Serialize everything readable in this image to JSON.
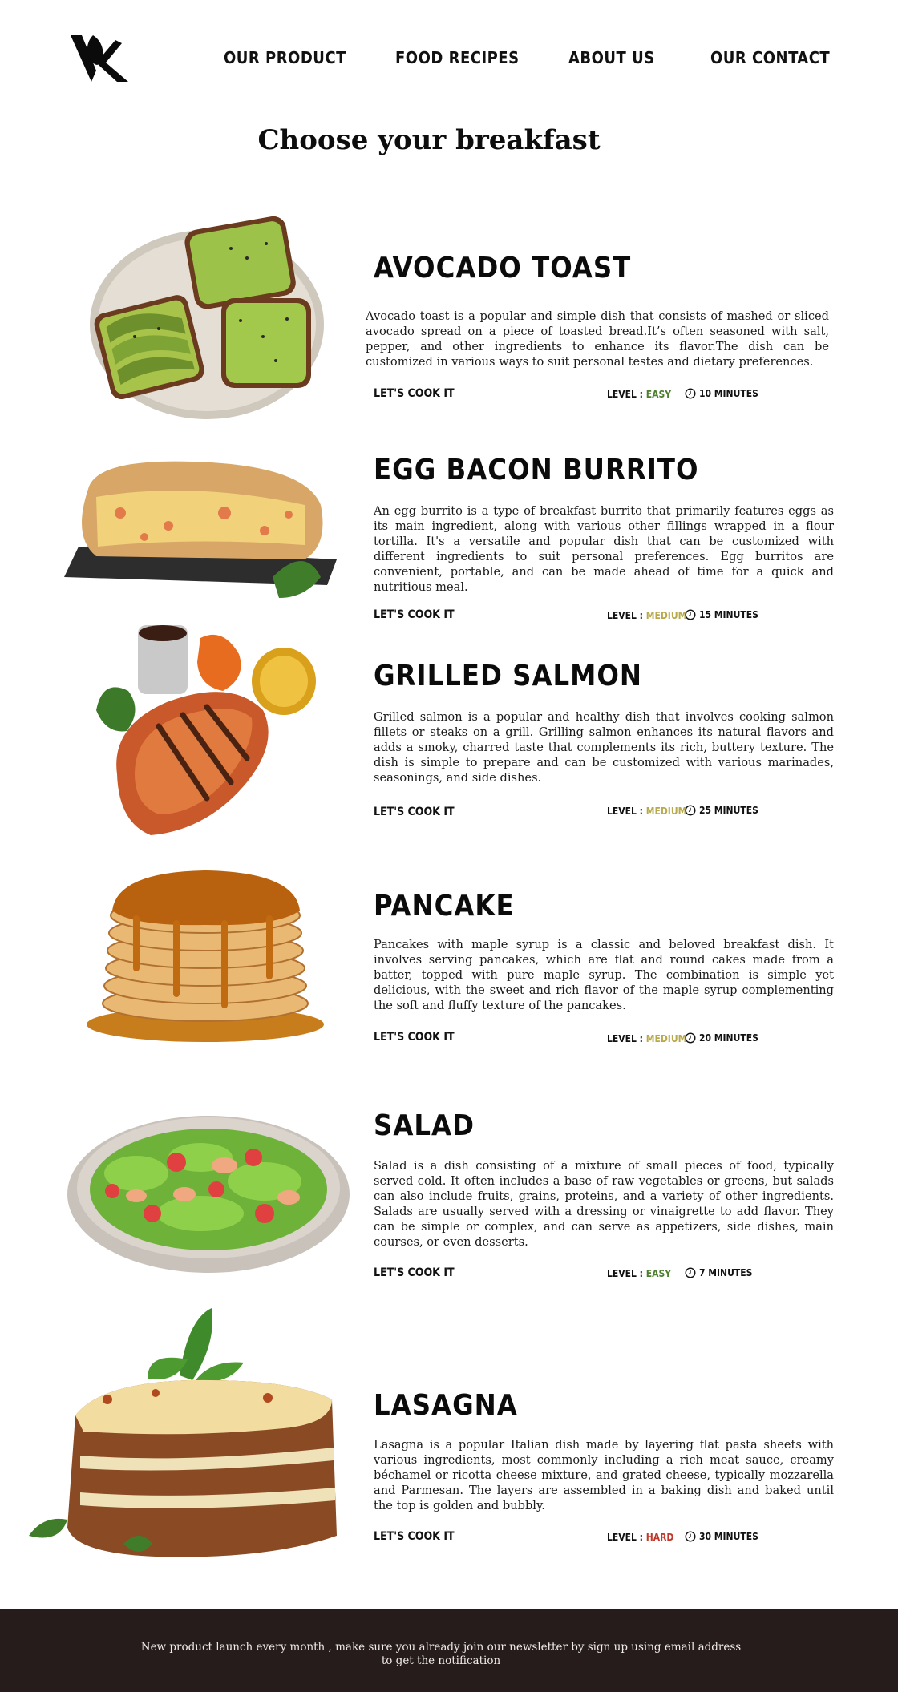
{
  "header": {
    "nav": [
      "OUR PRODUCT",
      "FOOD RECIPES",
      "ABOUT US",
      "OUR CONTACT"
    ]
  },
  "page_title": "Choose your breakfast",
  "colors": {
    "easy": "#4e7f2e",
    "medium": "#b8a94a",
    "hard": "#c0392b",
    "footer_bg": "#261c1c"
  },
  "recipes": [
    {
      "name": "AVOCADO TOAST",
      "description": "Avocado toast is a popular and simple dish that consists of mashed or sliced avocado spread on a piece of toasted bread.It’s often seasoned with salt, pepper, and other ingredients to enhance its flavor.The dish can be customized in various ways to suit personal testes and dietary preferences.",
      "cta": "LET'S COOK IT",
      "level_label": "LEVEL :",
      "level": "EASY",
      "time": "10 MINUTES",
      "image": "avocado-toast-plate"
    },
    {
      "name": "EGG BACON BURRITO",
      "description": "An egg burrito is a type of breakfast burrito that primarily features eggs as its main ingredient, along with various other fillings wrapped in a flour tortilla. It's a versatile and popular dish that can be customized with different ingredients to suit personal preferences. Egg burritos are convenient, portable, and can be made ahead of time for a quick and nutritious meal.",
      "cta": "LET'S COOK IT",
      "level_label": "LEVEL :",
      "level": "MEDIUM",
      "time": "15 MINUTES",
      "image": "egg-burrito-board"
    },
    {
      "name": "GRILLED SALMON",
      "description": "Grilled salmon is a popular and healthy dish that involves cooking salmon fillets or steaks on a grill. Grilling salmon enhances its natural flavors and adds a smoky, charred taste that complements its rich, buttery texture. The dish is simple to prepare and can be customized with various marinades, seasonings, and side dishes.",
      "cta": "LET'S COOK IT",
      "level_label": "LEVEL :",
      "level": "MEDIUM",
      "time": "25 MINUTES",
      "image": "grilled-salmon-lemon"
    },
    {
      "name": "PANCAKE",
      "description": "Pancakes with maple syrup is a classic and beloved breakfast dish. It involves serving pancakes, which are flat and round cakes made from a batter, topped with pure maple syrup. The combination is simple yet delicious, with the sweet and rich flavor of the maple syrup complementing the soft and fluffy texture of the pancakes.",
      "cta": "LET'S COOK IT",
      "level_label": "LEVEL :",
      "level": "MEDIUM",
      "time": "20 MINUTES",
      "image": "pancake-stack-syrup"
    },
    {
      "name": "SALAD",
      "description": "Salad is a dish consisting of a mixture of small pieces of food, typically served cold. It often includes a base of raw vegetables or greens, but salads can also include fruits, grains, proteins, and a variety of other ingredients. Salads are usually served with a dressing or vinaigrette to add flavor. They can be simple or complex, and can serve as appetizers, side dishes, main courses, or even desserts.",
      "cta": "LET'S COOK IT",
      "level_label": "LEVEL :",
      "level": "EASY",
      "time": "7 MINUTES",
      "image": "salad-bowl"
    },
    {
      "name": "LASAGNA",
      "description": "Lasagna is a popular Italian dish made by layering flat pasta sheets with various ingredients, most commonly including a rich meat sauce, creamy béchamel or ricotta cheese mixture, and grated cheese, typically mozzarella and Parmesan. The layers are assembled in a baking dish and baked until the top is golden and bubbly.",
      "cta": "LET'S COOK IT",
      "level_label": "LEVEL :",
      "level": "HARD",
      "time": "30 MINUTES",
      "image": "lasagna-slice-basil"
    }
  ],
  "footer": {
    "text": "New product launch every month , make sure you already join our newsletter by sign up using email address to get the notification"
  }
}
